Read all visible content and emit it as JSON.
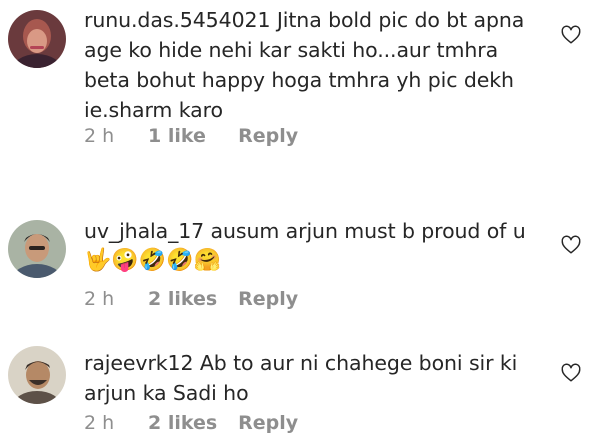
{
  "comments": [
    {
      "username": "runu.das.5454021",
      "text": "Jitna bold pic do bt apna age ko hide nehi kar sakti ho...aur tmhra beta bohut happy hoga tmhra yh pic dekh ie.sharm karo",
      "emojis": "",
      "time": "2 h",
      "likes": "1 like",
      "reply": "Reply",
      "like_icon": "heart-outline-icon"
    },
    {
      "username": "uv_jhala_17",
      "text": "ausum arjun must b proud of u",
      "emojis": "🤟🤪🤣🤣🤗",
      "time": "2 h",
      "likes": "2 likes",
      "reply": "Reply",
      "like_icon": "heart-outline-icon"
    },
    {
      "username": "rajeevrk12",
      "text": "Ab to aur ni chahege boni sir ki arjun ka Sadi ho",
      "emojis": "",
      "time": "2 h",
      "likes": "2 likes",
      "reply": "Reply",
      "like_icon": "heart-outline-icon"
    }
  ]
}
